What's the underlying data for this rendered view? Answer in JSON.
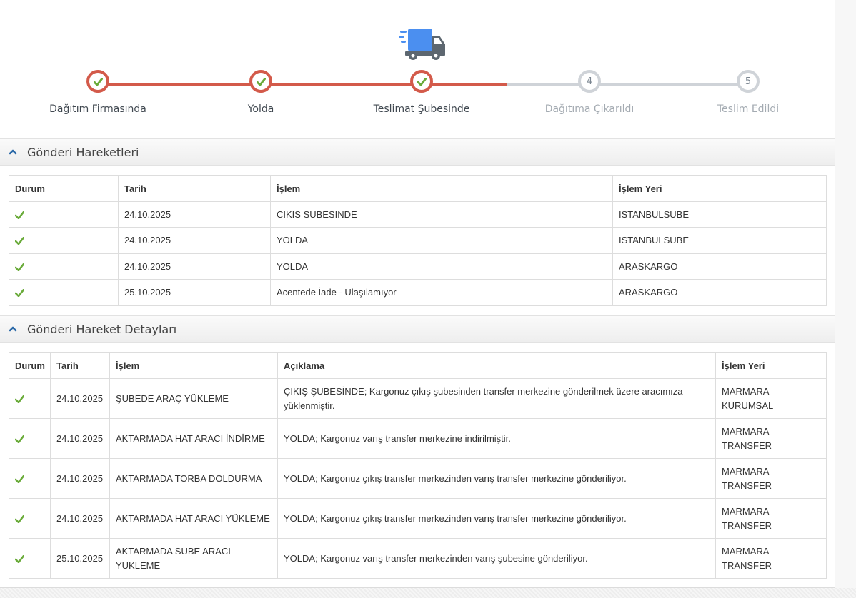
{
  "tracker": {
    "steps": [
      {
        "label": "Dağıtım Firmasında",
        "status": "done",
        "marker": ""
      },
      {
        "label": "Yolda",
        "status": "done",
        "marker": ""
      },
      {
        "label": "Teslimat Şubesinde",
        "status": "done",
        "marker": ""
      },
      {
        "label": "Dağıtıma Çıkarıldı",
        "status": "pending",
        "marker": "4"
      },
      {
        "label": "Teslim Edildi",
        "status": "pending",
        "marker": "5"
      }
    ],
    "truck_icon": "truck-icon",
    "done_color": "#d35a4a",
    "pending_color": "#cfd3d8",
    "check_color": "#6aab3a",
    "truck_color": "#4b8ff0"
  },
  "movements": {
    "title": "Gönderi Hareketleri",
    "headers": [
      "Durum",
      "Tarih",
      "İşlem",
      "İşlem Yeri"
    ],
    "rows": [
      {
        "status": "check",
        "date": "24.10.2025",
        "operation": "CIKIS SUBESINDE",
        "place": "ISTANBULSUBE"
      },
      {
        "status": "check",
        "date": "24.10.2025",
        "operation": "YOLDA",
        "place": "ISTANBULSUBE"
      },
      {
        "status": "check",
        "date": "24.10.2025",
        "operation": "YOLDA",
        "place": "ARASKARGO"
      },
      {
        "status": "check",
        "date": "25.10.2025",
        "operation": "Acentede İade - Ulaşılamıyor",
        "place": "ARASKARGO"
      }
    ]
  },
  "details": {
    "title": "Gönderi Hareket Detayları",
    "headers": [
      "Durum",
      "Tarih",
      "İşlem",
      "Açıklama",
      "İşlem Yeri"
    ],
    "rows": [
      {
        "status": "check",
        "date": "24.10.2025",
        "operation": "ŞUBEDE ARAÇ YÜKLEME",
        "description": "ÇIKIŞ ŞUBESİNDE; Kargonuz çıkış şubesinden transfer merkezine gönderilmek üzere aracımıza yüklenmiştir.",
        "place": "MARMARA KURUMSAL"
      },
      {
        "status": "check",
        "date": "24.10.2025",
        "operation": "AKTARMADA HAT ARACI İNDİRME",
        "description": "YOLDA; Kargonuz varış transfer merkezine indirilmiştir.",
        "place": "MARMARA TRANSFER"
      },
      {
        "status": "check",
        "date": "24.10.2025",
        "operation": "AKTARMADA TORBA DOLDURMA",
        "description": "YOLDA; Kargonuz çıkış transfer merkezinden varış transfer merkezine gönderiliyor.",
        "place": "MARMARA TRANSFER"
      },
      {
        "status": "check",
        "date": "24.10.2025",
        "operation": "AKTARMADA HAT ARACI YÜKLEME",
        "description": "YOLDA; Kargonuz çıkış transfer merkezinden varış transfer merkezine gönderiliyor.",
        "place": "MARMARA TRANSFER"
      },
      {
        "status": "check",
        "date": "25.10.2025",
        "operation": "AKTARMADA SUBE ARACI YUKLEME",
        "description": "YOLDA; Kargonuz varış transfer merkezinden varış şubesine gönderiliyor.",
        "place": "MARMARA TRANSFER"
      }
    ]
  }
}
